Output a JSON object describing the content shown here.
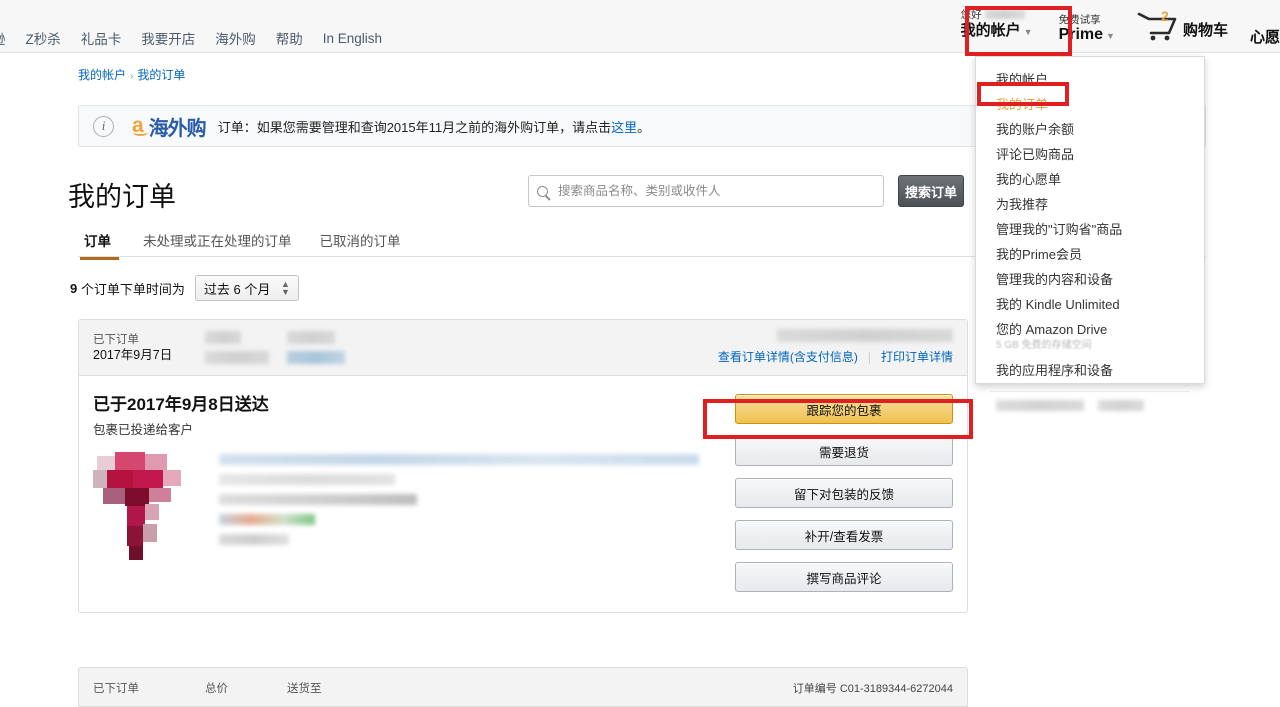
{
  "topnav": {
    "links": [
      "逊",
      "Z秒杀",
      "礼品卡",
      "我要开店",
      "海外购",
      "帮助",
      "In English"
    ],
    "account": {
      "greeting": "您好",
      "label": "我的帐户",
      "caret": "▼"
    },
    "prime": {
      "top": "免费试享",
      "label": "Prime",
      "caret": "▼"
    },
    "cart": {
      "count": "2",
      "label": "购物车",
      "icon": "shopping-cart-icon"
    },
    "wishlist": {
      "label": "心愿"
    }
  },
  "account_menu": {
    "items": [
      {
        "label": "我的帐户",
        "active": false
      },
      {
        "label": "我的订单",
        "active": true
      },
      {
        "label": "我的账户余额",
        "active": false
      },
      {
        "label": "评论已购商品",
        "active": false
      },
      {
        "label": "我的心愿单",
        "active": false
      },
      {
        "label": "为我推荐",
        "active": false
      },
      {
        "label": "管理我的\"订购省\"商品",
        "active": false
      },
      {
        "label": "我的Prime会员",
        "active": false
      },
      {
        "label": "管理我的内容和设备",
        "active": false
      },
      {
        "label": "我的 Kindle Unlimited",
        "active": false
      },
      {
        "label": "您的 Amazon Drive",
        "sub": "5 GB 免费的存储空间",
        "active": false
      },
      {
        "label": "我的应用程序和设备",
        "active": false
      }
    ]
  },
  "breadcrumb": {
    "root": "我的帐户",
    "separator": "›",
    "current": "我的订单"
  },
  "notice": {
    "icon": "info-icon",
    "logo_a": "a",
    "logo_text": "海外购",
    "text_before": "订单：如果您需要管理和查询2015年11月之前的海外购订单，请点击",
    "link": "这里",
    "text_after": "。"
  },
  "page": {
    "title": "我的订单"
  },
  "search": {
    "placeholder": "搜索商品名称、类别或收件人",
    "value": "",
    "button": "搜索订单",
    "icon": "search-icon"
  },
  "tabs": [
    {
      "label": "订单",
      "active": true
    },
    {
      "label": "未处理或正在处理的订单",
      "active": false
    },
    {
      "label": "已取消的订单",
      "active": false
    }
  ],
  "filter": {
    "count": "9",
    "text": "个订单下单时间为",
    "selected": "过去 6 个月",
    "arrows": "⇅"
  },
  "order": {
    "head": {
      "placed_label": "已下订单",
      "placed_date": "2017年9月7日",
      "link_details": "查看订单详情(含支付信息)",
      "link_print": "打印订单详情"
    },
    "delivered_title": "已于2017年9月8日送达",
    "delivered_sub": "包裹已投递给客户",
    "buttons": [
      {
        "label": "跟踪您的包裹",
        "primary": true
      },
      {
        "label": "需要退货",
        "primary": false
      },
      {
        "label": "留下对包装的反馈",
        "primary": false
      },
      {
        "label": "补开/查看发票",
        "primary": false
      },
      {
        "label": "撰写商品评论",
        "primary": false
      }
    ]
  },
  "next_order": {
    "col1": "已下订单",
    "col2": "总价",
    "col3": "送货至",
    "order_number": "订单编号 C01-3189344-6272044"
  },
  "colors": {
    "accent_yellow": "#f0c14b",
    "link_blue": "#0066c0",
    "annotation_red": "#e02020",
    "tab_underline": "#b06a1e",
    "logo_blue": "#2a5ca8",
    "logo_orange": "#f0a33c"
  }
}
